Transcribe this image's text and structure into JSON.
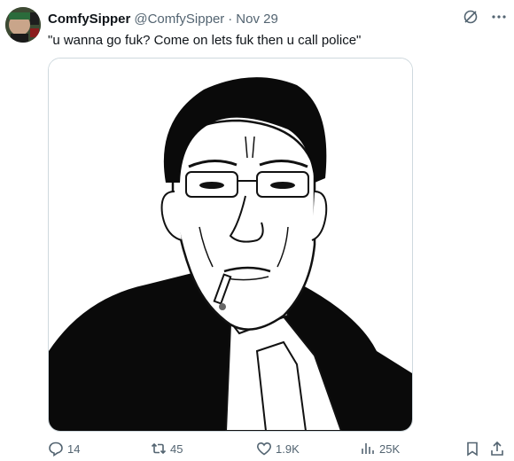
{
  "tweet": {
    "display_name": "ComfySipper",
    "handle": "@ComfySipper",
    "separator": "·",
    "date": "Nov 29",
    "text": "\"u wanna go fuk? Come on lets fuk then u call police\""
  },
  "avatar": {
    "caption": "Unable to be determined"
  },
  "actions": {
    "replies": "14",
    "reposts": "45",
    "likes": "1.9K",
    "views": "25K"
  },
  "icons": {
    "header": [
      "grok-icon",
      "more-icon"
    ],
    "actions": [
      "reply-icon",
      "repost-icon",
      "like-icon",
      "views-icon",
      "bookmark-icon",
      "share-icon"
    ]
  }
}
